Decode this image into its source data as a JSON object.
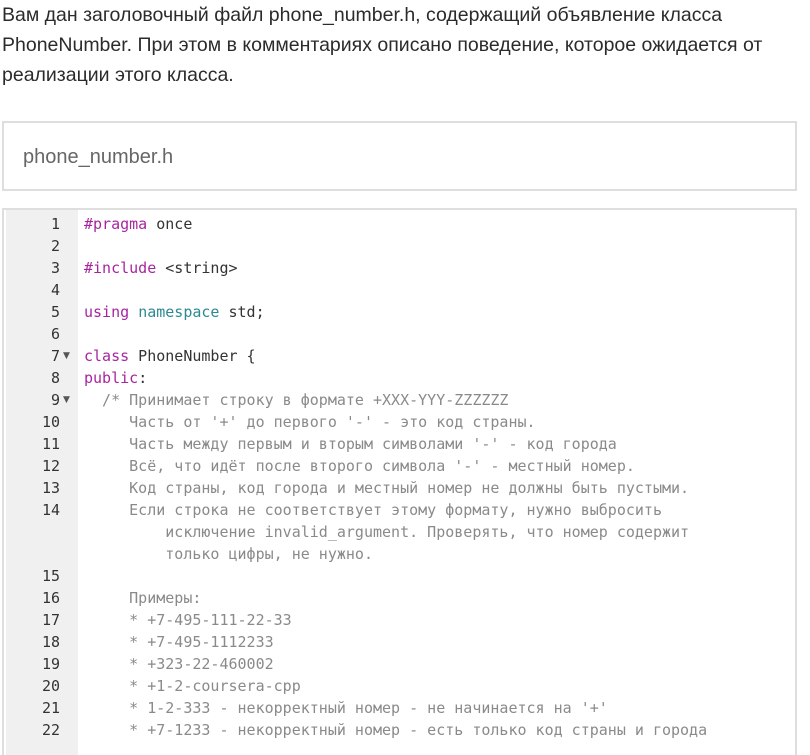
{
  "intro": {
    "text": "Вам дан заголовочный файл phone_number.h, содержащий объявление класса PhoneNumber. При этом в комментариях описано поведение, которое ожидается от реализации этого класса."
  },
  "file_tab": {
    "label": "phone_number.h"
  },
  "editor": {
    "fold_icon": "fold-arrow-down-icon",
    "lines": [
      {
        "n": "1",
        "segs": [
          {
            "t": "#pragma",
            "c": "kw"
          },
          {
            "t": " once",
            "c": "plain"
          }
        ]
      },
      {
        "n": "2",
        "segs": []
      },
      {
        "n": "3",
        "segs": [
          {
            "t": "#include",
            "c": "kw"
          },
          {
            "t": " <string>",
            "c": "plain"
          }
        ]
      },
      {
        "n": "4",
        "segs": []
      },
      {
        "n": "5",
        "segs": [
          {
            "t": "using",
            "c": "kw"
          },
          {
            "t": " ",
            "c": "plain"
          },
          {
            "t": "namespace",
            "c": "ns"
          },
          {
            "t": " std;",
            "c": "plain"
          }
        ]
      },
      {
        "n": "6",
        "segs": []
      },
      {
        "n": "7",
        "fold": true,
        "segs": [
          {
            "t": "class",
            "c": "kw"
          },
          {
            "t": " PhoneNumber {",
            "c": "plain"
          }
        ]
      },
      {
        "n": "8",
        "segs": [
          {
            "t": "public",
            "c": "kw"
          },
          {
            "t": ":",
            "c": "plain"
          }
        ]
      },
      {
        "n": "9",
        "fold": true,
        "segs": [
          {
            "t": "  /* Принимает строку в формате +XXX-YYY-ZZZZZZ",
            "c": "cm"
          }
        ]
      },
      {
        "n": "10",
        "segs": [
          {
            "t": "     Часть от '+' до первого '-' - это код страны.",
            "c": "cm"
          }
        ]
      },
      {
        "n": "11",
        "segs": [
          {
            "t": "     Часть между первым и вторым символами '-' - код города",
            "c": "cm"
          }
        ]
      },
      {
        "n": "12",
        "segs": [
          {
            "t": "     Всё, что идёт после второго символа '-' - местный номер.",
            "c": "cm"
          }
        ]
      },
      {
        "n": "13",
        "segs": [
          {
            "t": "     Код страны, код города и местный номер не должны быть пустыми.",
            "c": "cm"
          }
        ]
      },
      {
        "n": "14",
        "segs": [
          {
            "t": "     Если строка не соответствует этому формату, нужно выбросить",
            "c": "cm"
          }
        ],
        "wrap": [
          "         исключение invalid_argument. Проверять, что номер содержит",
          "         только цифры, не нужно."
        ]
      },
      {
        "n": "15",
        "segs": []
      },
      {
        "n": "16",
        "segs": [
          {
            "t": "     Примеры:",
            "c": "cm"
          }
        ]
      },
      {
        "n": "17",
        "segs": [
          {
            "t": "     * +7-495-111-22-33",
            "c": "cm"
          }
        ]
      },
      {
        "n": "18",
        "segs": [
          {
            "t": "     * +7-495-1112233",
            "c": "cm"
          }
        ]
      },
      {
        "n": "19",
        "segs": [
          {
            "t": "     * +323-22-460002",
            "c": "cm"
          }
        ]
      },
      {
        "n": "20",
        "segs": [
          {
            "t": "     * +1-2-coursera-cpp",
            "c": "cm"
          }
        ]
      },
      {
        "n": "21",
        "segs": [
          {
            "t": "     * 1-2-333 - некорректный номер - не начинается на '+'",
            "c": "cm"
          }
        ]
      },
      {
        "n": "22",
        "segs": [
          {
            "t": "     * +7-1233 - некорректный номер - есть только код страны и города",
            "c": "cm"
          }
        ]
      }
    ]
  }
}
